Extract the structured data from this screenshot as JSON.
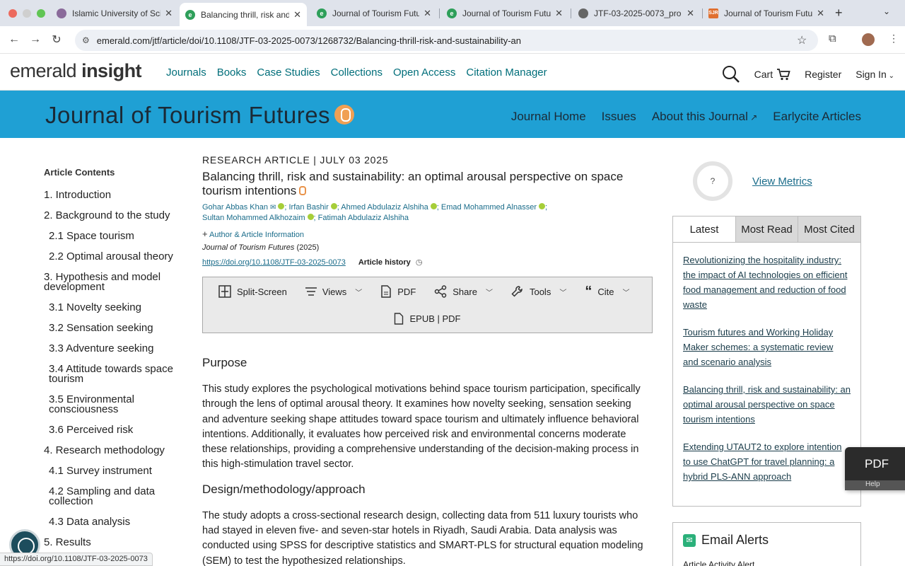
{
  "browser": {
    "tabs": [
      {
        "title": "Islamic University of Sci",
        "favicon": "globe-icon"
      },
      {
        "title": "Balancing thrill, risk and",
        "favicon": "emerald-icon"
      },
      {
        "title": "Journal of Tourism Futur",
        "favicon": "emerald-icon"
      },
      {
        "title": "Journal of Tourism Futur",
        "favicon": "emerald-icon"
      },
      {
        "title": "JTF-03-2025-0073_pro",
        "favicon": "globe-icon"
      },
      {
        "title": "Journal of Tourism Futur",
        "favicon": "sjr-icon"
      }
    ],
    "url": "emerald.com/jtf/article/doi/10.1108/JTF-03-2025-0073/1268732/Balancing-thrill-risk-and-sustainability-an",
    "status_url": "https://doi.org/10.1108/JTF-03-2025-0073"
  },
  "site": {
    "logo_a": "emerald",
    "logo_b": "insight",
    "nav": [
      "Journals",
      "Books",
      "Case Studies",
      "Collections",
      "Open Access",
      "Citation Manager"
    ],
    "cart": "Cart",
    "register": "Register",
    "sign_in": "Sign In"
  },
  "journal": {
    "title": "Journal of Tourism Futures",
    "nav": [
      "Journal Home",
      "Issues",
      "About this Journal",
      "Earlycite Articles"
    ]
  },
  "toc": {
    "heading": "Article Contents",
    "items": [
      {
        "label": "1. Introduction",
        "sub": false
      },
      {
        "label": "2. Background to the study",
        "sub": false
      },
      {
        "label": "2.1 Space tourism",
        "sub": true
      },
      {
        "label": "2.2 Optimal arousal theory",
        "sub": true
      },
      {
        "label": "3. Hypothesis and model development",
        "sub": false
      },
      {
        "label": "3.1 Novelty seeking",
        "sub": true
      },
      {
        "label": "3.2 Sensation seeking",
        "sub": true
      },
      {
        "label": "3.3 Adventure seeking",
        "sub": true
      },
      {
        "label": "3.4 Attitude towards space tourism",
        "sub": true
      },
      {
        "label": "3.5 Environmental consciousness",
        "sub": true
      },
      {
        "label": "3.6 Perceived risk",
        "sub": true
      },
      {
        "label": "4. Research methodology",
        "sub": false
      },
      {
        "label": "4.1 Survey instrument",
        "sub": true
      },
      {
        "label": "4.2 Sampling and data collection",
        "sub": true
      },
      {
        "label": "4.3 Data analysis",
        "sub": true
      },
      {
        "label": "5. Results",
        "sub": false
      }
    ]
  },
  "article": {
    "kicker": "RESEARCH ARTICLE |  JULY 03 2025",
    "title": "Balancing thrill, risk and sustainability: an optimal arousal perspective on space tourism intentions",
    "authors": [
      "Gohar Abbas Khan",
      "Irfan Bashir",
      "Ahmed Abdulaziz Alshiha",
      "Emad Mohammed Alnasser",
      "Sultan Mohammed Alkhozaim",
      "Fatimah Abdulaziz Alshiha"
    ],
    "author_info": "Author & Article Information",
    "journal_cite": "Journal of Tourism Futures",
    "year": "(2025)",
    "doi": "https://doi.org/10.1108/JTF-03-2025-0073",
    "history": "Article history",
    "tools": {
      "split": "Split-Screen",
      "views": "Views",
      "pdf": "PDF",
      "share": "Share",
      "tools": "Tools",
      "cite": "Cite",
      "epub": "EPUB | PDF"
    },
    "sections": [
      {
        "heading": "Purpose",
        "text": "This study explores the psychological motivations behind space tourism participation, specifically through the lens of optimal arousal theory. It examines how novelty seeking, sensation seeking and adventure seeking shape attitudes toward space tourism and ultimately influence behavioral intentions. Additionally, it evaluates how perceived risk and environmental concerns moderate these relationships, providing a comprehensive understanding of the decision-making process in this high-stimulation travel sector."
      },
      {
        "heading": "Design/methodology/approach",
        "text": "The study adopts a cross-sectional research design, collecting data from 511 luxury tourists who had stayed in eleven five- and seven-star hotels in Riyadh, Saudi Arabia. Data analysis was conducted using SPSS for descriptive statistics and SMART-PLS for structural equation modeling (SEM) to test the hypothesized relationships."
      }
    ]
  },
  "sidebar": {
    "metrics_placeholder": "?",
    "view_metrics": "View Metrics",
    "tabs": [
      "Latest",
      "Most Read",
      "Most Cited"
    ],
    "items": [
      "Revolutionizing the hospitality industry: the impact of AI technologies on efficient food management and reduction of food waste",
      "Tourism futures and Working Holiday Maker schemes: a systematic review and scenario analysis",
      "Balancing thrill, risk and sustainability: an optimal arousal perspective on space tourism intentions",
      "Extending UTAUT2 to explore intention to use ChatGPT for travel planning: a hybrid PLS-ANN approach"
    ],
    "pdf_float": "PDF",
    "help": "Help",
    "alerts_title": "Email Alerts",
    "alerts_sub": "Article Activity Alert"
  }
}
